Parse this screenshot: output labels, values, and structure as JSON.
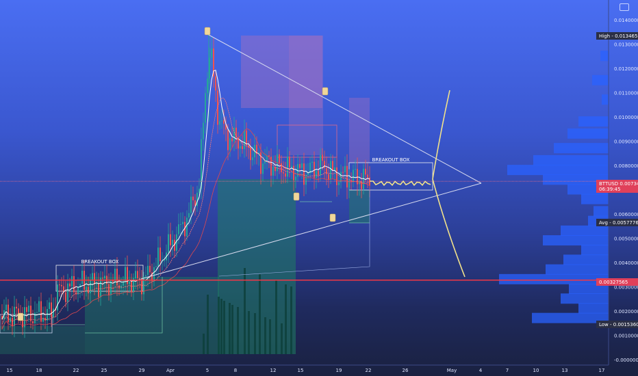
{
  "chart_data": {
    "type": "candlestick",
    "symbol": "BTTUSD",
    "x_tick_labels": [
      "15",
      "18",
      "22",
      "25",
      "29",
      "Apr",
      "5",
      "8",
      "12",
      "15",
      "19",
      "22",
      "26",
      "May",
      "4",
      "7",
      "10",
      "13",
      "17"
    ],
    "y_tick_labels": [
      "0.01400000",
      "0.01300000",
      "0.01200000",
      "0.01100000",
      "0.01000000",
      "0.00900000",
      "0.00800000",
      "0.00700000",
      "0.00600000",
      "0.00500000",
      "0.00400000",
      "0.00300000",
      "0.00200000",
      "0.00100000",
      "-0.00000000"
    ],
    "ylim": [
      -0.0,
      0.014
    ],
    "price_labels": {
      "high": {
        "label": "High",
        "value": "0.01346500"
      },
      "last": {
        "label": "BTTUSD",
        "value": "0.00734640",
        "countdown": "06:39:45"
      },
      "avg": {
        "label": "Avg",
        "value": "0.00577763"
      },
      "support": {
        "value": "0.00327565"
      },
      "low": {
        "label": "Low",
        "value": "0.00153600"
      }
    },
    "annotations": [
      "BREAKOUT BOX",
      "BREAKOUT BOX"
    ],
    "grid": false
  },
  "colors": {
    "up": "#26a69a",
    "down": "#ef5350",
    "projection": "#f3e38a",
    "support_line": "#f23645",
    "volume_profile": "#2962ff"
  },
  "toolbar": {
    "icon": "screenshot-icon"
  }
}
